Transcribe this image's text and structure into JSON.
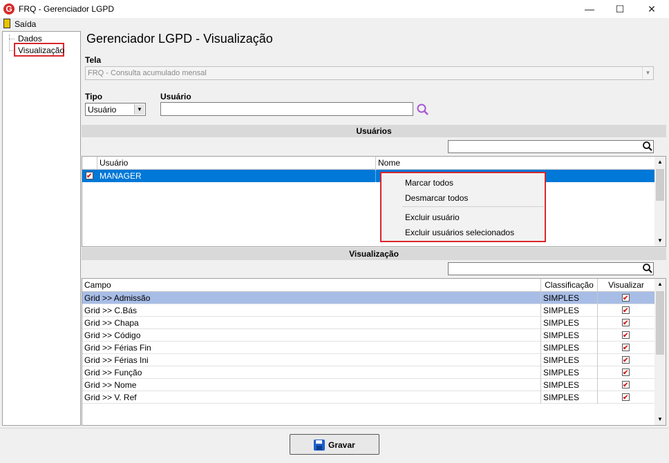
{
  "window": {
    "title": "FRQ - Gerenciador LGPD",
    "minimize": "—",
    "maximize": "☐",
    "close": "✕"
  },
  "menu": {
    "saida": "Saída"
  },
  "tree": {
    "items": [
      {
        "label": "Dados"
      },
      {
        "label": "Visualização",
        "selected": true
      }
    ]
  },
  "page": {
    "title": "Gerenciador LGPD - Visualização"
  },
  "tela": {
    "label": "Tela",
    "value": "FRQ - Consulta acumulado mensal"
  },
  "tipo": {
    "label": "Tipo",
    "value": "Usuário"
  },
  "usuario": {
    "label": "Usuário",
    "value": ""
  },
  "usuarios_section": {
    "title": "Usuários",
    "search_value": "",
    "columns": [
      "Usuário",
      "Nome"
    ],
    "rows": [
      {
        "checked": true,
        "usuario": "MANAGER",
        "nome": ""
      }
    ]
  },
  "context_menu": {
    "items": [
      "Marcar todos",
      "Desmarcar todos",
      "Excluir usuário",
      "Excluir usuários selecionados"
    ]
  },
  "visualizacao_section": {
    "title": "Visualização",
    "search_value": "",
    "columns": [
      "Campo",
      "Classificação",
      "Visualizar"
    ],
    "rows": [
      {
        "campo": "Grid >> Admissão",
        "classificacao": "SIMPLES",
        "visualizar": true
      },
      {
        "campo": "Grid >> C.Bás",
        "classificacao": "SIMPLES",
        "visualizar": true
      },
      {
        "campo": "Grid >> Chapa",
        "classificacao": "SIMPLES",
        "visualizar": true
      },
      {
        "campo": "Grid >> Código",
        "classificacao": "SIMPLES",
        "visualizar": true
      },
      {
        "campo": "Grid >> Férias Fin",
        "classificacao": "SIMPLES",
        "visualizar": true
      },
      {
        "campo": "Grid >> Férias Ini",
        "classificacao": "SIMPLES",
        "visualizar": true
      },
      {
        "campo": "Grid >> Função",
        "classificacao": "SIMPLES",
        "visualizar": true
      },
      {
        "campo": "Grid >> Nome",
        "classificacao": "SIMPLES",
        "visualizar": true
      },
      {
        "campo": "Grid >> V. Ref",
        "classificacao": "SIMPLES",
        "visualizar": true
      }
    ]
  },
  "footer": {
    "gravar_label": "Gravar"
  },
  "colors": {
    "selected_row": "#0078d7",
    "highlight_row": "#a8bde6",
    "annotation_red": "#d9262c"
  }
}
